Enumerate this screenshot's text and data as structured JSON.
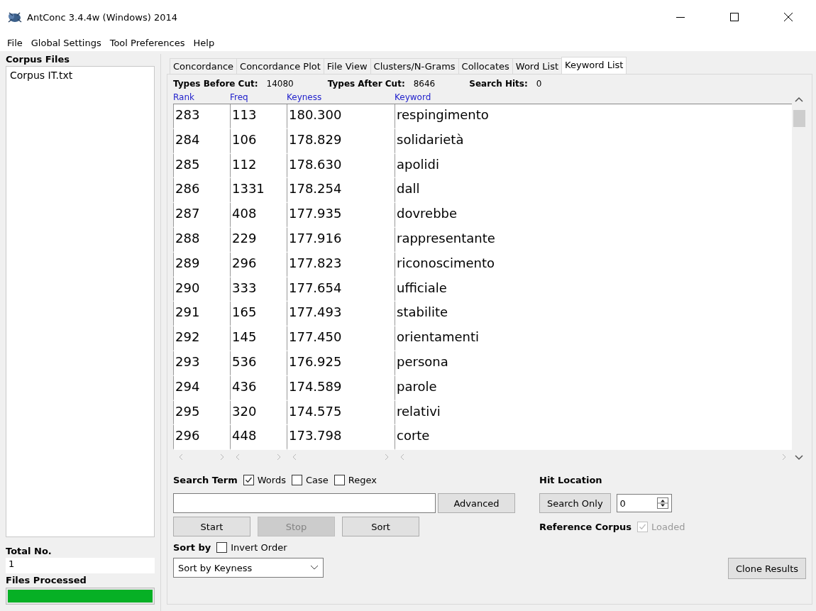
{
  "window": {
    "title": "AntConc 3.4.4w (Windows) 2014"
  },
  "menu": [
    "File",
    "Global Settings",
    "Tool Preferences",
    "Help"
  ],
  "sidebar": {
    "title": "Corpus Files",
    "files": [
      "Corpus IT.txt"
    ],
    "total_label": "Total No.",
    "total_value": "1",
    "progress_label": "Files Processed",
    "progress": {
      "level": 1
    }
  },
  "tabs": [
    {
      "label": "Concordance",
      "selected": false
    },
    {
      "label": "Concordance Plot",
      "selected": false
    },
    {
      "label": "File View",
      "selected": false
    },
    {
      "label": "Clusters/N-Grams",
      "selected": false
    },
    {
      "label": "Collocates",
      "selected": false
    },
    {
      "label": "Word List",
      "selected": false
    },
    {
      "label": "Keyword List",
      "selected": true
    }
  ],
  "stats": [
    {
      "label": "Types Before Cut:",
      "value": "14080"
    },
    {
      "label": "Types After Cut:",
      "value": "8646"
    },
    {
      "label": "Search Hits:",
      "value": "0"
    }
  ],
  "table": {
    "columns": [
      "Rank",
      "Freq",
      "Keyness",
      "Keyword"
    ],
    "rows": [
      [
        "283",
        "113",
        "180.300",
        "respingimento"
      ],
      [
        "284",
        "106",
        "178.829",
        "solidarietà"
      ],
      [
        "285",
        "112",
        "178.630",
        "apolidi"
      ],
      [
        "286",
        "1331",
        "178.254",
        "dall"
      ],
      [
        "287",
        "408",
        "177.935",
        "dovrebbe"
      ],
      [
        "288",
        "229",
        "177.916",
        "rappresentante"
      ],
      [
        "289",
        "296",
        "177.823",
        "riconoscimento"
      ],
      [
        "290",
        "333",
        "177.654",
        "ufficiale"
      ],
      [
        "291",
        "165",
        "177.493",
        "stabilite"
      ],
      [
        "292",
        "145",
        "177.450",
        "orientamenti"
      ],
      [
        "293",
        "536",
        "176.925",
        "persona"
      ],
      [
        "294",
        "436",
        "174.589",
        "parole"
      ],
      [
        "295",
        "320",
        "174.575",
        "relativi"
      ],
      [
        "296",
        "448",
        "173.798",
        "corte"
      ]
    ]
  },
  "search": {
    "label": "Search Term",
    "options": [
      {
        "label": "Words",
        "checked": true
      },
      {
        "label": "Case",
        "checked": false
      },
      {
        "label": "Regex",
        "checked": false
      }
    ],
    "advanced_button": "Advanced"
  },
  "actions": [
    {
      "label": "Start",
      "disabled": false
    },
    {
      "label": "Stop",
      "disabled": true
    },
    {
      "label": "Sort",
      "disabled": false
    }
  ],
  "sort": {
    "label": "Sort by",
    "invert": {
      "label": "Invert Order",
      "checked": false
    },
    "value": "Sort by Keyness"
  },
  "hit_location": {
    "label": "Hit Location",
    "button": "Search Only",
    "value": "0"
  },
  "reference_corpus": {
    "label": "Reference Corpus",
    "option": {
      "label": "Loaded",
      "checked": true,
      "disabled": true
    }
  },
  "clone_button": "Clone Results"
}
